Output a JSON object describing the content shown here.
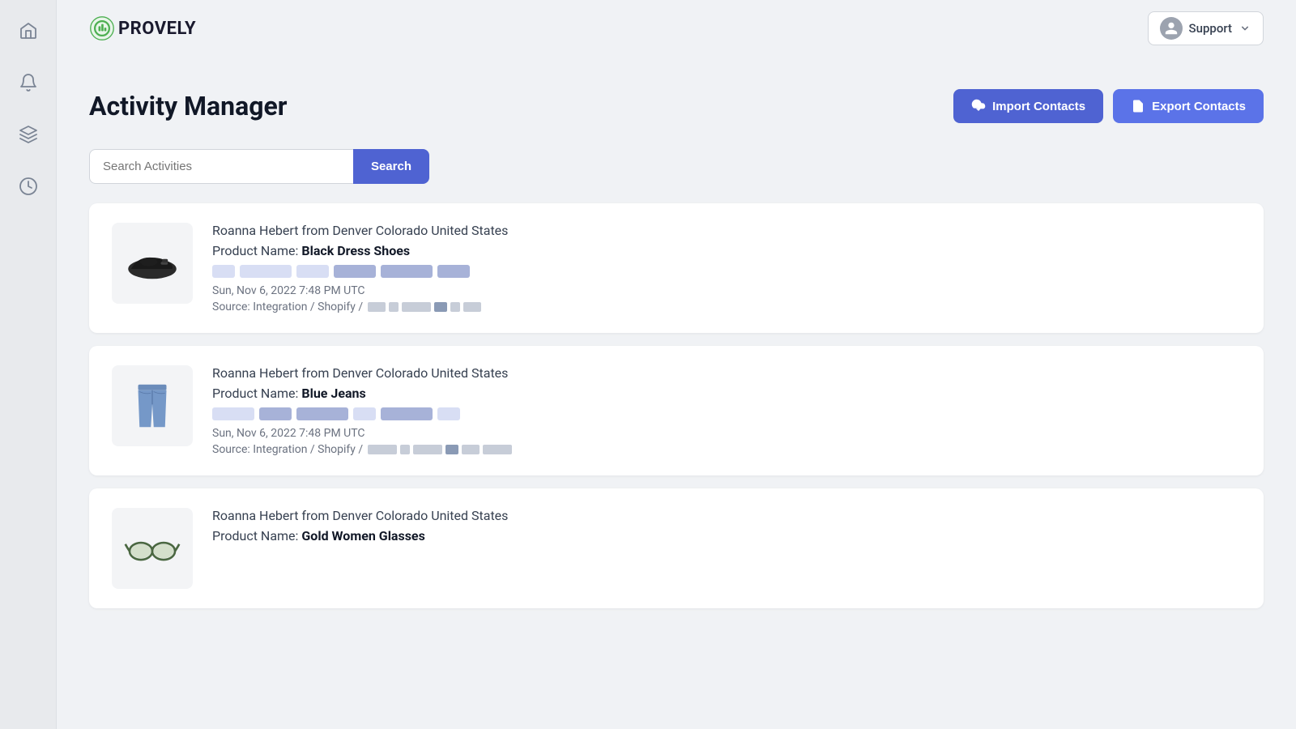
{
  "app": {
    "name": "PROVELY",
    "logo_icon": "chart-icon"
  },
  "topbar": {
    "user": {
      "name": "Support",
      "avatar_icon": "user-icon",
      "dropdown_icon": "chevron-down-icon"
    }
  },
  "sidebar": {
    "items": [
      {
        "name": "home",
        "icon": "home-icon"
      },
      {
        "name": "notifications",
        "icon": "bell-icon"
      },
      {
        "name": "layers",
        "icon": "layers-icon"
      },
      {
        "name": "history",
        "icon": "clock-icon"
      }
    ]
  },
  "page": {
    "title": "Activity Manager",
    "import_button": "Import Contacts",
    "export_button": "Export Contacts",
    "search": {
      "placeholder": "Search Activities",
      "button_label": "Search"
    }
  },
  "activities": [
    {
      "id": 1,
      "contact": "Roanna Hebert from Denver Colorado United States",
      "product_label": "Product Name:",
      "product_name": "Black Dress Shoes",
      "timestamp": "Sun, Nov 6, 2022 7:48 PM UTC",
      "source": "Source: Integration / Shopify /"
    },
    {
      "id": 2,
      "contact": "Roanna Hebert from Denver Colorado United States",
      "product_label": "Product Name:",
      "product_name": "Blue Jeans",
      "timestamp": "Sun, Nov 6, 2022 7:48 PM UTC",
      "source": "Source: Integration / Shopify /"
    },
    {
      "id": 3,
      "contact": "Roanna Hebert from Denver Colorado United States",
      "product_label": "Product Name:",
      "product_name": "Gold Women Glasses",
      "timestamp": "",
      "source": ""
    }
  ]
}
